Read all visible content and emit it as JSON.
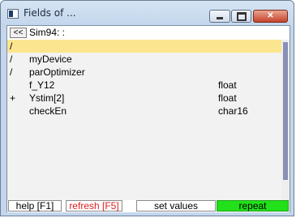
{
  "window": {
    "title": "Fields of ..."
  },
  "title_buttons": {
    "minimize": "–",
    "maximize": "□",
    "close": "✕"
  },
  "pathbar": {
    "back_label": "<<",
    "path": "Sim94: :"
  },
  "rows": [
    {
      "mark": "/",
      "name": "",
      "type": ""
    },
    {
      "mark": "/",
      "name": "myDevice",
      "type": ""
    },
    {
      "mark": "/",
      "name": "parOptimizer",
      "type": ""
    },
    {
      "mark": "",
      "name": "f_Y12",
      "type": "float"
    },
    {
      "mark": "+",
      "name": "Ystim[2]",
      "type": "float"
    },
    {
      "mark": "",
      "name": "checkEn",
      "type": "char16"
    }
  ],
  "footer": {
    "help": "help [F1]",
    "refresh": "refresh [F5]",
    "set_values": "set values",
    "repeat": "repeat"
  },
  "colors": {
    "selected_row": "#fbe58f",
    "refresh_text": "#e02020",
    "repeat_bg": "#22e01a"
  }
}
